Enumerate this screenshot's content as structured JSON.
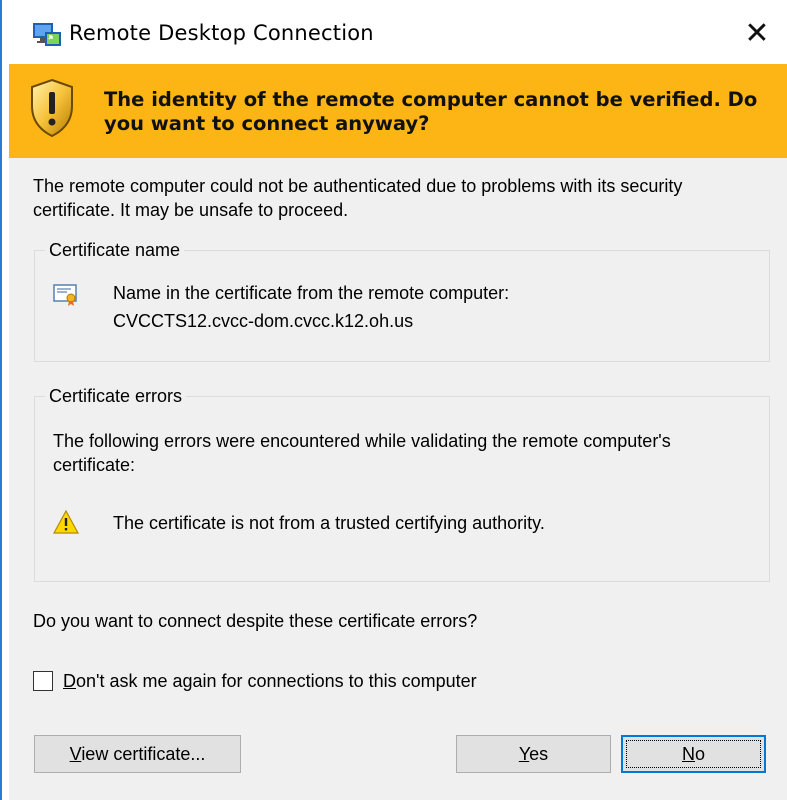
{
  "window": {
    "title": "Remote Desktop Connection",
    "close_glyph": "✕"
  },
  "banner": {
    "message": "The identity of the remote computer cannot be verified. Do you want to connect anyway?",
    "color": "#fcb515"
  },
  "intro": "The remote computer could not be authenticated due to problems with its security certificate. It may be unsafe to proceed.",
  "certificate_name": {
    "legend": "Certificate name",
    "line1": "Name in the certificate from the remote computer:",
    "line2": "CVCCTS12.cvcc-dom.cvcc.k12.oh.us"
  },
  "certificate_errors": {
    "legend": "Certificate errors",
    "description": "The following errors were encountered while validating the remote computer's certificate:",
    "error": "The certificate is not from a trusted certifying authority."
  },
  "question": "Do you want to connect despite these certificate errors?",
  "checkbox": {
    "label": "Don't ask me again for connections to this computer",
    "checked": false
  },
  "buttons": {
    "view_certificate": "View certificate...",
    "yes": "Yes",
    "no": "No"
  },
  "colors": {
    "accent": "#0078d7",
    "warning": "#fcb515"
  }
}
